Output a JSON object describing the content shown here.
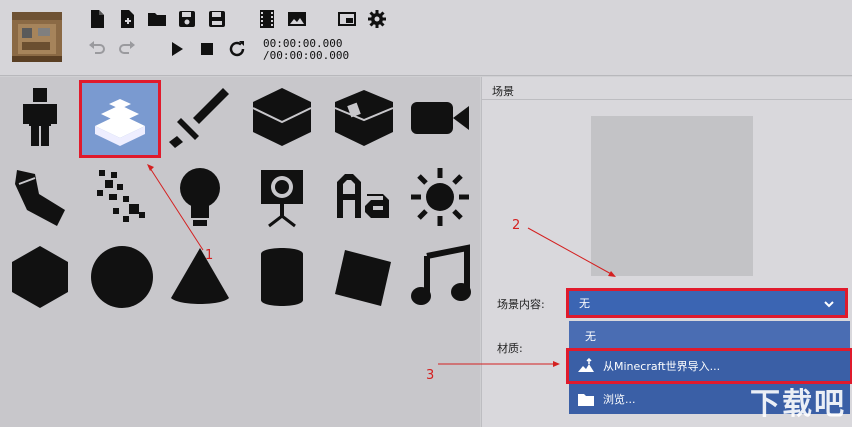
{
  "toolbar": {
    "time_current": "00:00:00.000",
    "time_total": "/00:00:00.000",
    "icons": [
      "new-file-icon",
      "new-file-plus-icon",
      "open-folder-icon",
      "save-icon",
      "save-all-icon",
      "film-icon",
      "image-icon",
      "picture-in-picture-icon",
      "gear-icon",
      "undo-icon",
      "redo-icon",
      "play-icon",
      "stop-icon",
      "refresh-icon"
    ]
  },
  "elements": {
    "items": [
      "player-figure-icon",
      "scenery-icon",
      "sword-icon",
      "block-icon",
      "chest-icon",
      "camera-icon",
      "arm-icon",
      "particles-icon",
      "lightbulb-icon",
      "spotlight-icon",
      "text-icon",
      "sun-icon",
      "hexagon-icon",
      "circle-icon",
      "cone-icon",
      "cylinder-icon",
      "cube-icon",
      "music-icon"
    ]
  },
  "scene": {
    "title": "场景",
    "content_label": "场景内容:",
    "material_label": "材质:",
    "dropdown_value": "无",
    "options": [
      {
        "label": "无",
        "icon": ""
      },
      {
        "label": "从Minecraft世界导入...",
        "icon": "terrain-import-icon"
      },
      {
        "label": "浏览...",
        "icon": "folder-icon"
      }
    ]
  },
  "annotations": {
    "n1": "1",
    "n2": "2",
    "n3": "3"
  },
  "watermark": "下载吧",
  "colors": {
    "accent_blue": "#3b65b3",
    "highlight_red": "#e01a2c",
    "selected_tile": "#7a9ad0"
  }
}
